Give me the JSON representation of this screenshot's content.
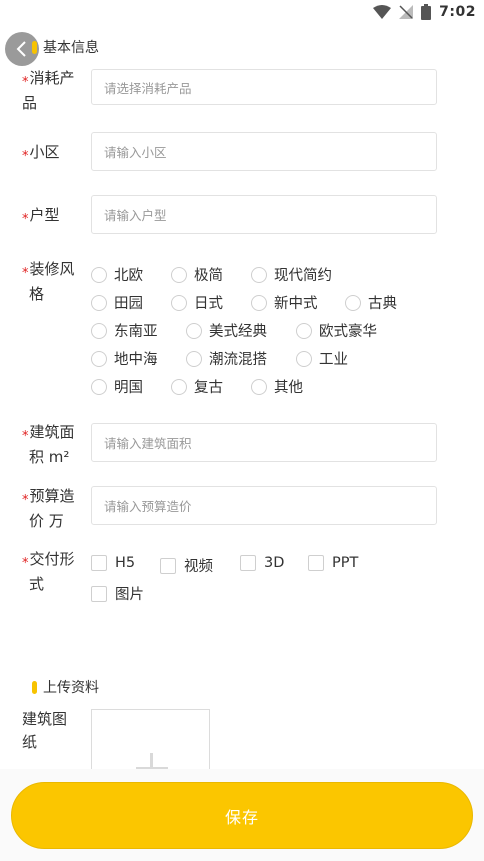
{
  "status": {
    "time": "7:02"
  },
  "section_basic": "基本信息",
  "fields": {
    "product": {
      "label_line1": "消耗产",
      "label_line2": "品",
      "placeholder": "请选择消耗产品"
    },
    "community": {
      "label": "小区",
      "placeholder": "请输入小区"
    },
    "layout": {
      "label": "户型",
      "placeholder": "请输入户型"
    },
    "style": {
      "label_line1": "装修风",
      "label_line2": "格",
      "options": [
        "北欧",
        "极简",
        "现代简约",
        "田园",
        "日式",
        "新中式",
        "古典",
        "东南亚",
        "美式经典",
        "欧式豪华",
        "地中海",
        "潮流混搭",
        "工业",
        "明国",
        "复古",
        "其他"
      ]
    },
    "area": {
      "label_line1": "建筑面",
      "label_line2": "积 m²",
      "placeholder": "请输入建筑面积"
    },
    "budget": {
      "label_line1": "预算造",
      "label_line2": "价 万",
      "placeholder": "请输入预算造价"
    },
    "delivery": {
      "label_line1": "交付形",
      "label_line2": "式",
      "options": [
        "H5",
        "视频",
        "3D",
        "PPT",
        "图片"
      ]
    }
  },
  "section_upload": "上传资料",
  "upload": {
    "label_line1": "建筑图",
    "label_line2": "纸"
  },
  "save_label": "保存",
  "colors": {
    "accent": "#fbc600",
    "required": "#e02020"
  }
}
